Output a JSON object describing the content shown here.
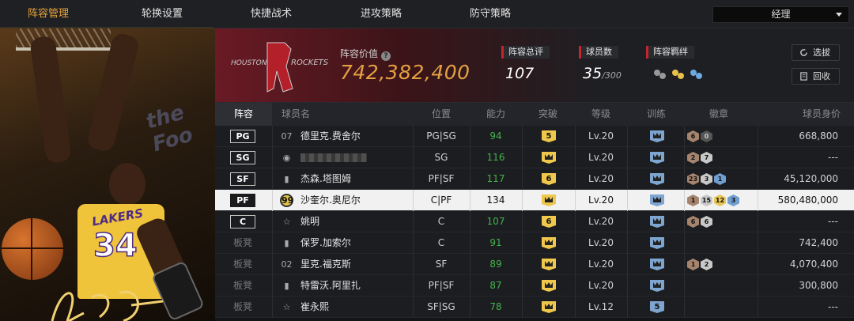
{
  "nav": {
    "tabs": [
      "阵容管理",
      "轮换设置",
      "快捷战术",
      "进攻策略",
      "防守策略"
    ],
    "active_index": 0,
    "role_select": "经理"
  },
  "hero": {
    "jersey_team": "LAKERS",
    "jersey_number": "34",
    "wall_text": "the Foo"
  },
  "team": {
    "logo_city": "HOUSTON",
    "logo_name": "ROCKETS",
    "value_label": "阵容价值",
    "value": "742,382,400",
    "overall_label": "阵容总评",
    "overall": "107",
    "players_label": "球员数",
    "players": "35",
    "players_max": "/300",
    "bond_label": "阵容羁绊",
    "btn_select": "选拔",
    "btn_recycle": "回收"
  },
  "columns": [
    "阵容",
    "球员名",
    "位置",
    "能力",
    "突破",
    "等级",
    "训练",
    "徽章",
    "球员身价"
  ],
  "rows": [
    {
      "slot": "PG",
      "bench": false,
      "num": "07",
      "gold": false,
      "name": "德里克.费舍尔",
      "pos": "PG|SG",
      "ability": "94",
      "green": true,
      "breakthrough": "5",
      "level": "Lv.20",
      "badges": [
        [
          "b-br",
          "6"
        ],
        [
          "b-dk",
          "0"
        ]
      ],
      "value": "668,800",
      "hl": false,
      "blur": false
    },
    {
      "slot": "SG",
      "bench": false,
      "num": "",
      "gold": false,
      "name": "",
      "pos": "SG",
      "ability": "116",
      "green": true,
      "breakthrough": "",
      "level": "Lv.20",
      "badges": [
        [
          "b-br",
          "2"
        ],
        [
          "b-sv",
          "7"
        ]
      ],
      "value": "---",
      "hl": false,
      "blur": true
    },
    {
      "slot": "SF",
      "bench": false,
      "num": "",
      "gold": false,
      "name": "杰森.塔图姆",
      "pos": "PF|SF",
      "ability": "117",
      "green": true,
      "breakthrough": "6",
      "level": "Lv.20",
      "badges": [
        [
          "b-br",
          "23"
        ],
        [
          "b-sv",
          "3"
        ],
        [
          "b-bl",
          "1"
        ]
      ],
      "value": "45,120,000",
      "hl": false,
      "blur": false
    },
    {
      "slot": "PF",
      "bench": false,
      "num": "99",
      "gold": true,
      "name": "沙奎尔.奥尼尔",
      "pos": "C|PF",
      "ability": "134",
      "green": false,
      "breakthrough": "",
      "level": "Lv.20",
      "badges": [
        [
          "b-br",
          "1"
        ],
        [
          "b-sv",
          "15"
        ],
        [
          "b-gd",
          "12"
        ],
        [
          "b-bl",
          "3"
        ]
      ],
      "value": "580,480,000",
      "hl": true,
      "blur": false
    },
    {
      "slot": "C",
      "bench": false,
      "num": "",
      "gold": false,
      "name": "姚明",
      "pos": "C",
      "ability": "107",
      "green": true,
      "breakthrough": "6",
      "level": "Lv.20",
      "badges": [
        [
          "b-br",
          "6"
        ],
        [
          "b-sv",
          "6"
        ]
      ],
      "value": "---",
      "hl": false,
      "blur": false
    },
    {
      "slot": "板凳",
      "bench": true,
      "num": "",
      "gold": false,
      "name": "保罗.加索尔",
      "pos": "C",
      "ability": "91",
      "green": true,
      "breakthrough": "",
      "level": "Lv.20",
      "badges": [],
      "value": "742,400",
      "hl": false,
      "blur": false
    },
    {
      "slot": "板凳",
      "bench": true,
      "num": "02",
      "gold": false,
      "name": "里克.福克斯",
      "pos": "SF",
      "ability": "89",
      "green": true,
      "breakthrough": "",
      "level": "Lv.20",
      "badges": [
        [
          "b-br",
          "1"
        ],
        [
          "b-sv",
          "2"
        ]
      ],
      "value": "4,070,400",
      "hl": false,
      "blur": false
    },
    {
      "slot": "板凳",
      "bench": true,
      "num": "",
      "gold": false,
      "name": "特雷沃.阿里扎",
      "pos": "PF|SF",
      "ability": "87",
      "green": true,
      "breakthrough": "",
      "level": "Lv.20",
      "badges": [],
      "value": "300,800",
      "hl": false,
      "blur": false
    },
    {
      "slot": "板凳",
      "bench": true,
      "num": "",
      "gold": false,
      "name": "崔永熙",
      "pos": "SF|SG",
      "ability": "78",
      "green": true,
      "breakthrough": "",
      "level": "Lv.12",
      "badges": [],
      "value": "---",
      "hl": false,
      "blur": false,
      "train": "5"
    }
  ]
}
